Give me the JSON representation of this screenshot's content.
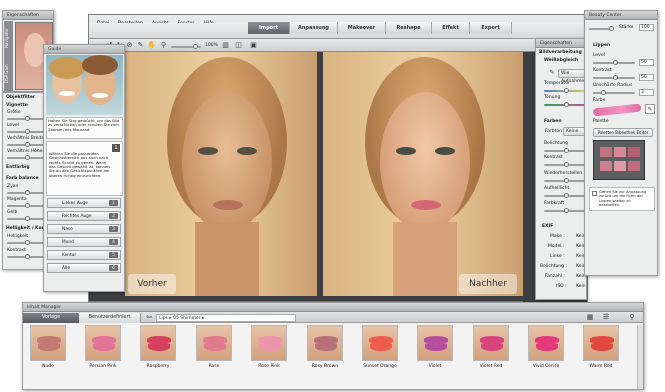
{
  "menu": [
    "Datei",
    "Bearbeiten",
    "Ansicht",
    "Fenster",
    "Hilfe"
  ],
  "toolbar": {
    "zoom": "100%"
  },
  "tabs": [
    "Import",
    "Anpassung",
    "Makeover",
    "Reshape",
    "Effekt",
    "Export"
  ],
  "compare": {
    "before_label": "Vorher",
    "after_label": "Nachher"
  },
  "navigator": {
    "title": "Eigenschaften",
    "tabs": [
      "Navigator",
      "DSP Gain"
    ]
  },
  "object_filter": {
    "title": "Objektfilter",
    "sections": [
      {
        "heading": "Vignette",
        "items": [
          "Größe",
          "Level",
          "Verhältnis Breite",
          "Verhältnis Höhe"
        ]
      },
      {
        "heading": "Entfärbig",
        "items": []
      },
      {
        "heading": "Farb balance",
        "items": [
          "Zyan",
          "Magenta",
          "Gelb"
        ]
      },
      {
        "heading": "Helligkeit / Kontr",
        "items": [
          "Helligkeit",
          "Kontrast"
        ]
      }
    ]
  },
  "guide": {
    "title": "Guide",
    "tip1": "Halten Sie Strg gedrückt, um das Bild zu verschieben oder scrollen Sie zum Zoomen des Mausrad.",
    "tip2": "Wählen Sie die passenden Gesichtsbereich aus auch nach rechts Schritt zu gehen. Wenn das Gesicht gewählt ist, können Sie an den Gesichtspunkten am oberen richtig einzurichten.",
    "steps": [
      {
        "label": "Linkes Auge",
        "num": "1"
      },
      {
        "label": "Rechtes Auge",
        "num": "2"
      },
      {
        "label": "Nase",
        "num": "3"
      },
      {
        "label": "Mund",
        "num": "4"
      },
      {
        "label": "Kontur",
        "num": "5"
      },
      {
        "label": "Alle",
        "num": "6"
      }
    ]
  },
  "adjust_panel": {
    "title": "Eigenschaften",
    "header": "Bildverarbeitung",
    "weissabgleich": "Weißabgleich",
    "wb_button": "Wie Aufnahme",
    "temperature": "Temperatur",
    "tint": "Tönung",
    "colors_heading": "Farben",
    "color_mode_label": "Farbton",
    "color_mode_value": "Keine",
    "rows": [
      "Belichtung",
      "Kontrast",
      "Wiederherstellen",
      "Aufhelllicht",
      "Farbkraft"
    ],
    "exif_heading": "EXIF",
    "exif": [
      {
        "label": "Make :",
        "value": "Kein"
      },
      {
        "label": "Model :",
        "value": "Kein"
      },
      {
        "label": "Linse :",
        "value": "Kein"
      },
      {
        "label": "Belichtung :",
        "value": "Kein"
      },
      {
        "label": "Fanzahl :",
        "value": "Kein"
      },
      {
        "label": "ISO :",
        "value": "Kein"
      }
    ]
  },
  "beauty": {
    "title": "Beauty Center",
    "strength_label": "Stärke",
    "strength_value": "100",
    "section": "Lippen",
    "level_label": "Level",
    "level_value": "50",
    "contrast_label": "Kontrast",
    "contrast_value": "50",
    "radius_label": "Unschärfe Radius",
    "radius_value": "3",
    "color_label": "Farbe",
    "palette_label": "Palette",
    "library_button": "Paletten Bibliothek Editor",
    "note": "Gehen Sie zur Anpassung zurück um die Form der Lippen wieder zu bearbeiten.",
    "palette_colors": [
      "#c2737f",
      "#d98796",
      "#b6606f",
      "#cf7f8d",
      "#e29aa8",
      "#c46d7c"
    ]
  },
  "inhalt": {
    "title": "Inhalt Manager",
    "tabs": [
      "Vorlage",
      "Benutzerdefiniert"
    ],
    "breadcrumb": [
      "Lips",
      "05 Shimmer"
    ],
    "items": [
      {
        "name": "Nude",
        "color": "#c27a72"
      },
      {
        "name": "Persian Pink",
        "color": "#e17398"
      },
      {
        "name": "Raspberry",
        "color": "#d4405e"
      },
      {
        "name": "Rose",
        "color": "#e07a8e"
      },
      {
        "name": "Rose Pink",
        "color": "#ec96ac"
      },
      {
        "name": "Rosy Brown",
        "color": "#b7707a"
      },
      {
        "name": "Sunset Orange",
        "color": "#ee5c4c"
      },
      {
        "name": "Violet",
        "color": "#b44e9d"
      },
      {
        "name": "Violet Red",
        "color": "#d7457c"
      },
      {
        "name": "Vivid Cerise",
        "color": "#e23a7a"
      },
      {
        "name": "Warm Red",
        "color": "#e2473d"
      }
    ]
  }
}
